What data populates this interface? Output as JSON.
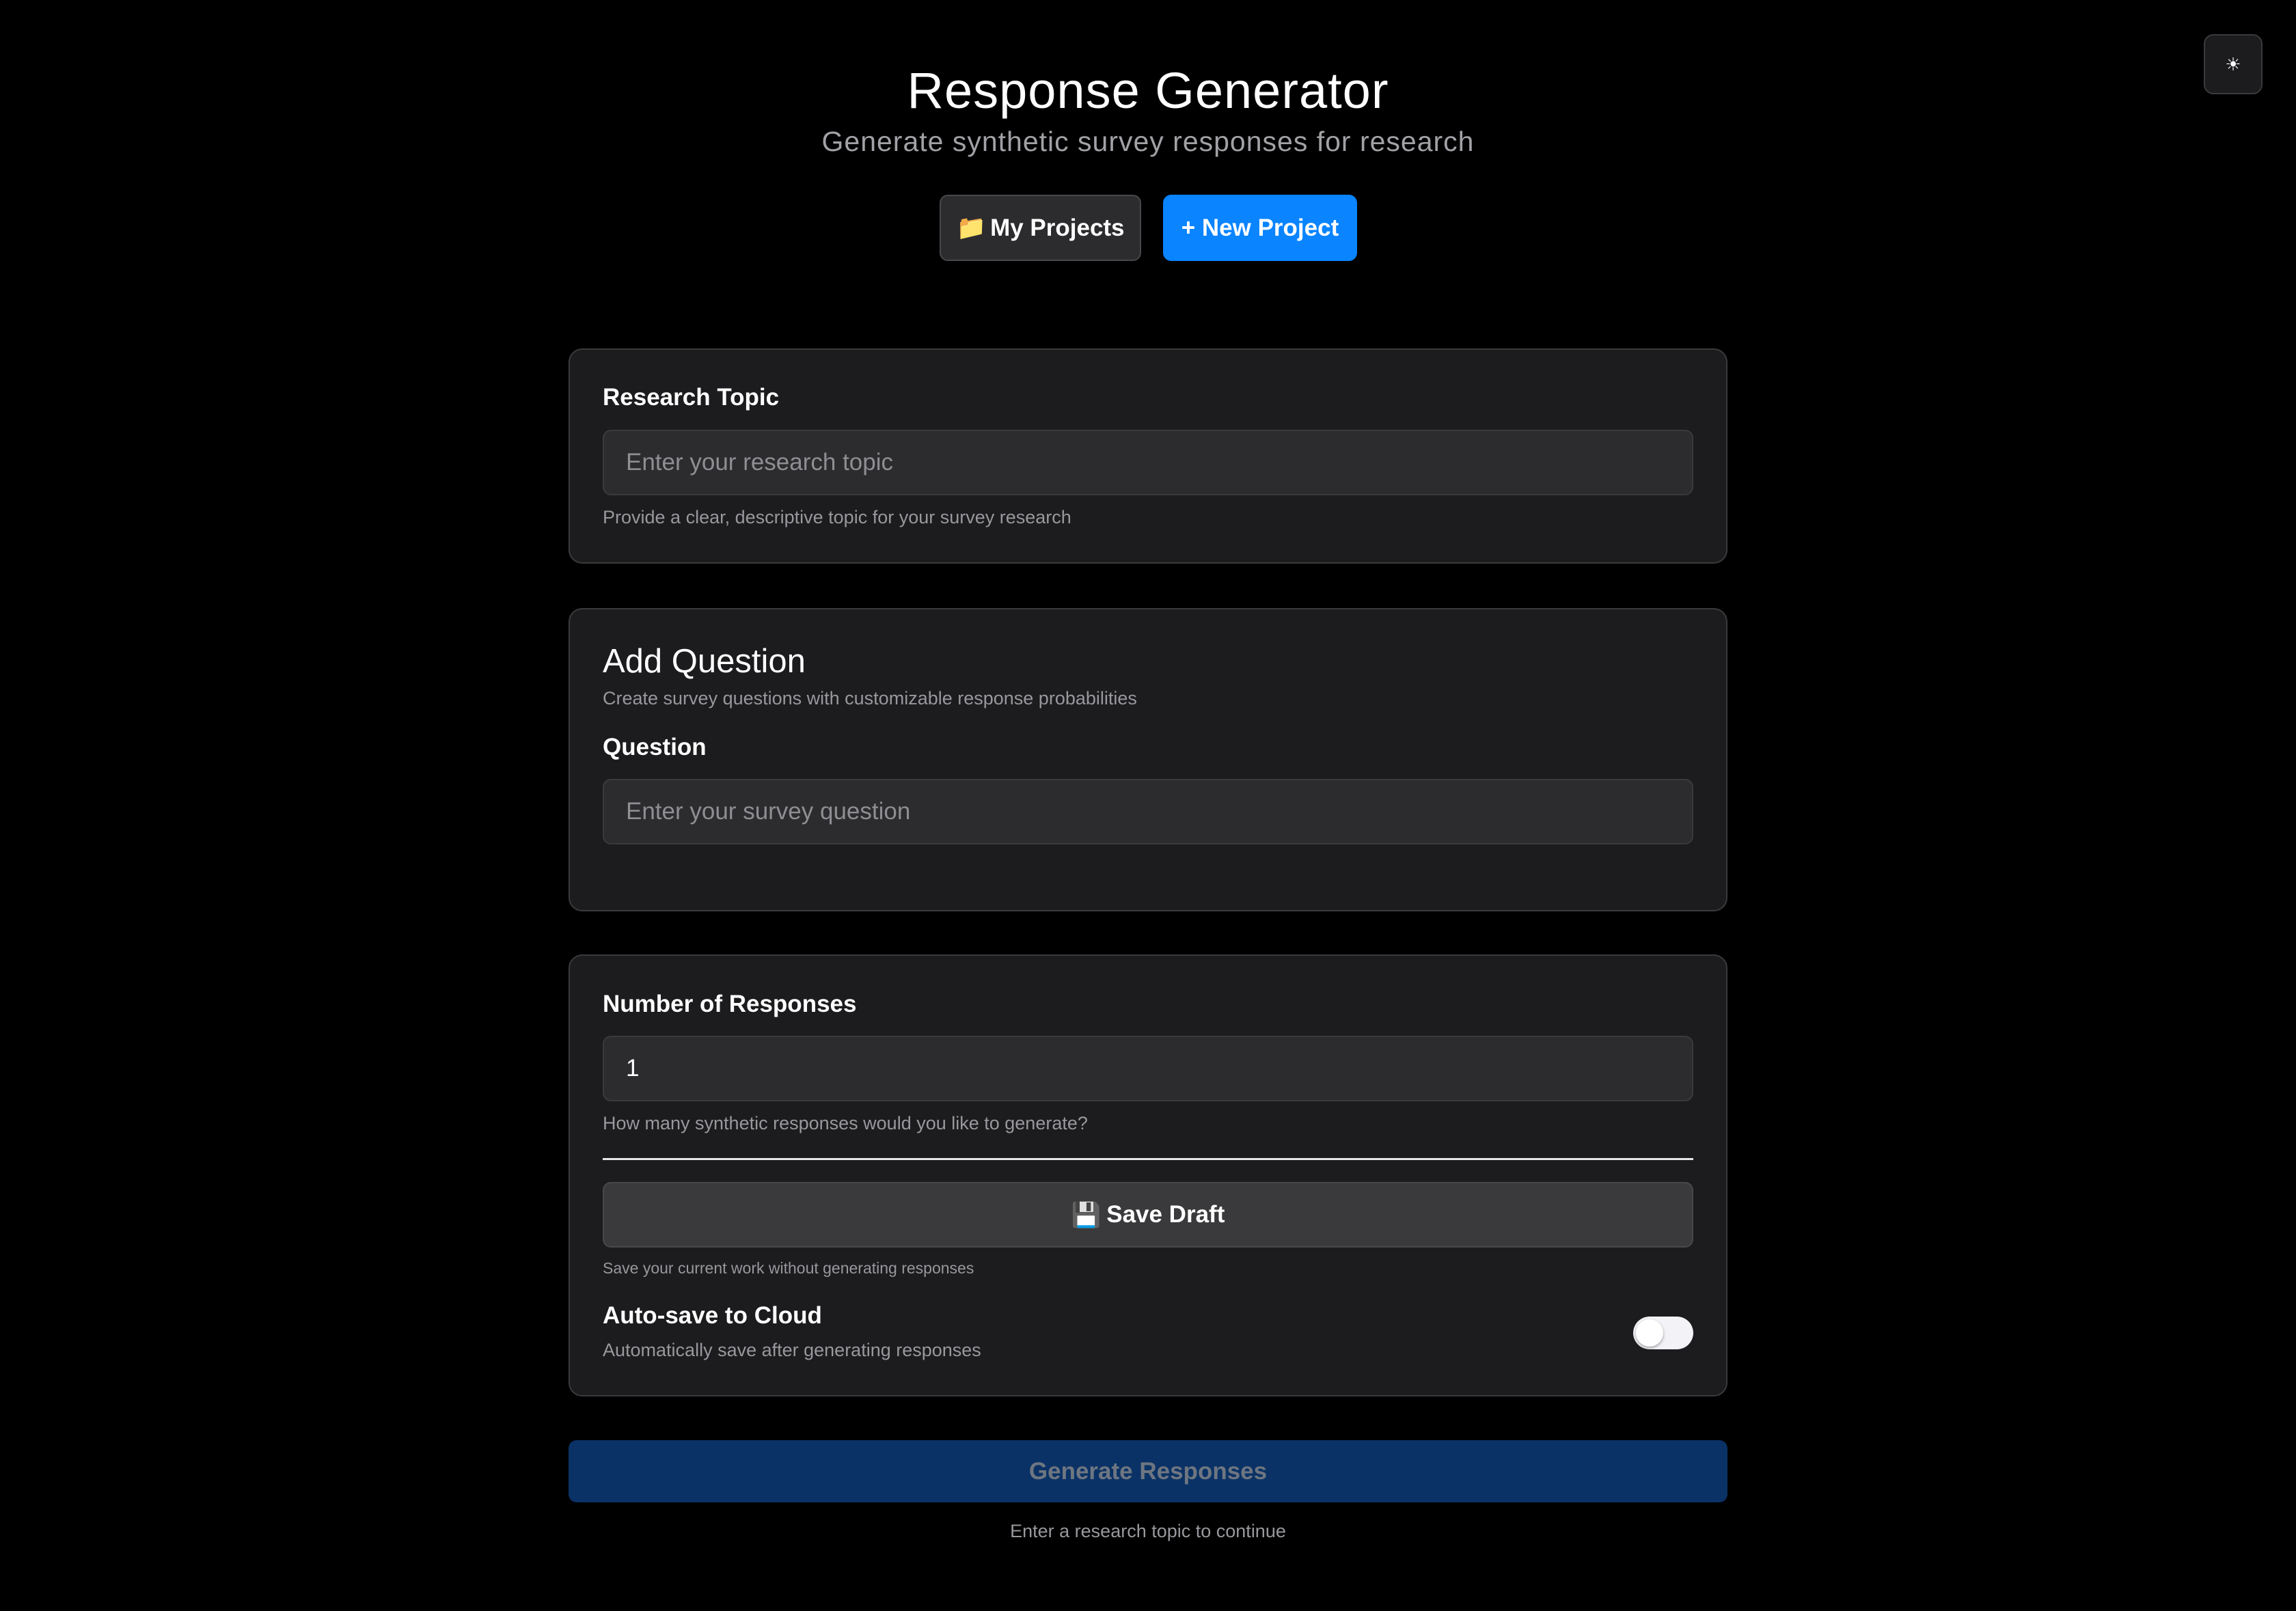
{
  "theme_toggle": {
    "icon": "sun-icon",
    "glyph": "☀"
  },
  "header": {
    "title": "Response Generator",
    "subtitle": "Generate synthetic survey responses for research"
  },
  "actions": {
    "my_projects_icon": "📁",
    "my_projects_label": "My Projects",
    "new_project_label": "+ New Project"
  },
  "research_topic": {
    "label": "Research Topic",
    "placeholder": "Enter your research topic",
    "value": "",
    "hint": "Provide a clear, descriptive topic for your survey research"
  },
  "add_question": {
    "title": "Add Question",
    "description": "Create survey questions with customizable response probabilities",
    "question_label": "Question",
    "question_placeholder": "Enter your survey question",
    "question_value": ""
  },
  "responses": {
    "label": "Number of Responses",
    "value": "1",
    "hint": "How many synthetic responses would you like to generate?",
    "save_icon": "💾",
    "save_label": "Save Draft",
    "save_hint": "Save your current work without generating responses",
    "autosave_label": "Auto-save to Cloud",
    "autosave_desc": "Automatically save after generating responses",
    "autosave_enabled": false
  },
  "generate": {
    "label": "Generate Responses",
    "hint": "Enter a research topic to continue",
    "disabled": true
  },
  "colors": {
    "background": "#000000",
    "card": "#1c1c1e",
    "accent": "#0a84ff",
    "accent_disabled": "#0a3266"
  }
}
